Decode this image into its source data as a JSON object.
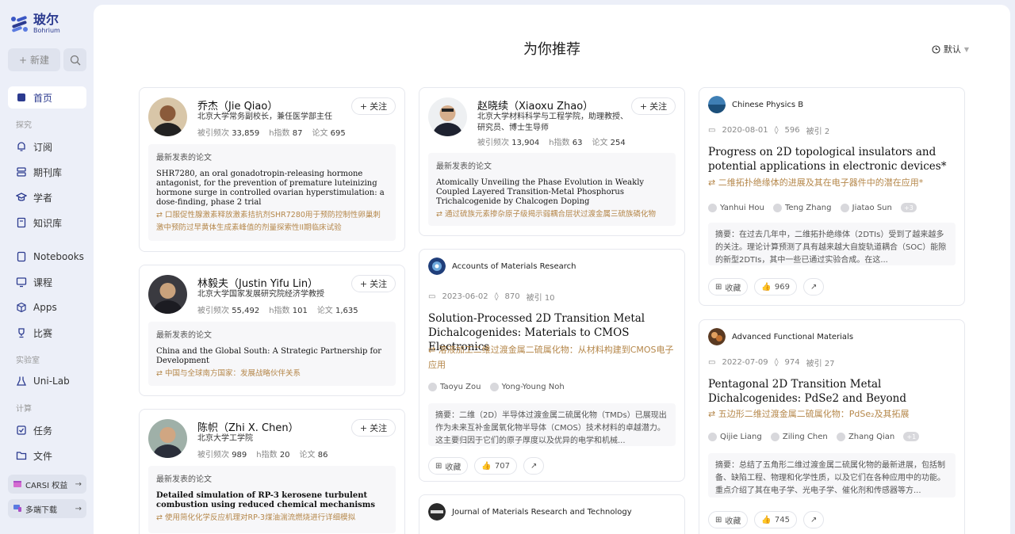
{
  "sidebar": {
    "logo_cn": "玻尔",
    "logo_en": "Bohrium",
    "new_label": "新建",
    "items": [
      {
        "label": "首页"
      },
      {
        "label": "订阅"
      },
      {
        "label": "期刊库"
      },
      {
        "label": "学者"
      },
      {
        "label": "知识库"
      },
      {
        "label": "Notebooks"
      },
      {
        "label": "课程"
      },
      {
        "label": "Apps"
      },
      {
        "label": "比赛"
      },
      {
        "label": "Uni-Lab"
      },
      {
        "label": "任务"
      },
      {
        "label": "文件"
      }
    ],
    "sections": [
      "探究",
      "实验室",
      "计算"
    ],
    "promos": [
      {
        "label": "CARSI 权益"
      },
      {
        "label": "多端下载"
      }
    ]
  },
  "main": {
    "title": "为你推荐",
    "sort_label": "默认"
  },
  "labels": {
    "follow": "关注",
    "latest": "最新发表的论文",
    "cites_prefix": "被引频次",
    "h_prefix": "h指数",
    "papers_prefix": "论文",
    "collect": "收藏",
    "cited_prefix": "被引",
    "abstract_prefix": "摘要："
  },
  "scholars": [
    {
      "name": "乔杰（Jie Qiao）",
      "affiliation": "北京大学常务副校长，兼任医学部主任",
      "cites": "33,859",
      "h": "87",
      "papers": "695",
      "latest_title": "SHR7280, an oral gonadotropin-releasing hormone antagonist, for the prevention of premature luteinizing hormone surge in controlled ovarian hyperstimulation: a dose-finding, phase 2 trial",
      "latest_cn": "口服促性腺激素释放激素拮抗剂SHR7280用于预防控制性卵巢刺激中预防过早黄体生成素峰值的剂量探索性II期临床试验"
    },
    {
      "name": "林毅夫（Justin Yifu Lin）",
      "affiliation": "北京大学国家发展研究院经济学教授",
      "cites": "55,492",
      "h": "101",
      "papers": "1,635",
      "latest_title": "China and the Global South: A Strategic Partnership for Development",
      "latest_cn": "中国与全球南方国家：发展战略伙伴关系"
    },
    {
      "name": "陈帜（Zhi X. Chen）",
      "affiliation": "北京大学工学院",
      "cites": "989",
      "h": "20",
      "papers": "86",
      "latest_title": "Detailed simulation of RP-3 kerosene turbulent combustion using reduced chemical mechanisms",
      "latest_cn": "使用简化化学反应机理对RP-3煤油湍流燃烧进行详细模拟"
    },
    {
      "name": "赵晓续（Xiaoxu Zhao）",
      "affiliation": "北京大学材料科学与工程学院，助理教授、研究员、博士生导师",
      "cites": "13,904",
      "h": "63",
      "papers": "254",
      "latest_title": "Atomically Unveiling the Phase Evolution in Weakly Coupled Layered Transition-Metal Phosphorus Trichalcogenide by Chalcogen Doping",
      "latest_cn": "通过硫族元素掺杂原子级揭示弱耦合层状过渡金属三硫族磷化物"
    }
  ],
  "papers": [
    {
      "journal": "Accounts of Materials Research",
      "date": "2023-06-02",
      "views": "870",
      "cited": "10",
      "title": "Solution-Processed 2D Transition Metal Dichalcogenides: Materials to CMOS Electronics",
      "title_cn": "溶液加工二维过渡金属二硫属化物：从材料构建到CMOS电子应用",
      "authors": [
        "Taoyu Zou",
        "Yong-Young Noh"
      ],
      "abstract": "二维（2D）半导体过渡金属二硫属化物（TMDs）已展现出作为未来互补金属氧化物半导体（CMOS）技术材料的卓越潜力。这主要归因于它们的原子厚度以及优异的电学和机械...",
      "likes": "707"
    },
    {
      "journal": "Journal of Materials Research and Technology"
    },
    {
      "journal": "Chinese Physics B",
      "date": "2020-08-01",
      "views": "596",
      "cited": "2",
      "title": "Progress on 2D topological insulators and potential applications in electronic devices*",
      "title_cn": "二维拓扑绝缘体的进展及其在电子器件中的潜在应用*",
      "authors": [
        "Yanhui Hou",
        "Teng Zhang",
        "Jiatao Sun"
      ],
      "more": "+3",
      "abstract": "在过去几年中，二维拓扑绝缘体（2DTIs）受到了越来越多的关注。理论计算预测了具有越来越大自旋轨道耦合（SOC）能隙的新型2DTIs，其中一些已通过实验合成。在这...",
      "likes": "969"
    },
    {
      "journal": "Advanced Functional Materials",
      "date": "2022-07-09",
      "views": "974",
      "cited": "27",
      "title": "Pentagonal 2D Transition Metal Dichalcogenides: PdSe2 and Beyond",
      "title_cn": "五边形二维过渡金属二硫属化物：PdSe₂及其拓展",
      "authors": [
        "Qijie Liang",
        "Ziling Chen",
        "Zhang Qian"
      ],
      "more": "+1",
      "abstract": "总结了五角形二维过渡金属二硫属化物的最新进展，包括制备、缺陷工程、物理和化学性质，以及它们在各种应用中的功能。重点介绍了其在电子学、光电子学、催化剂和传感器等方...",
      "likes": "745"
    }
  ],
  "colors": {
    "accent": "#2b3a8f",
    "translation": "#b5874a",
    "panel": "#eceff8"
  }
}
